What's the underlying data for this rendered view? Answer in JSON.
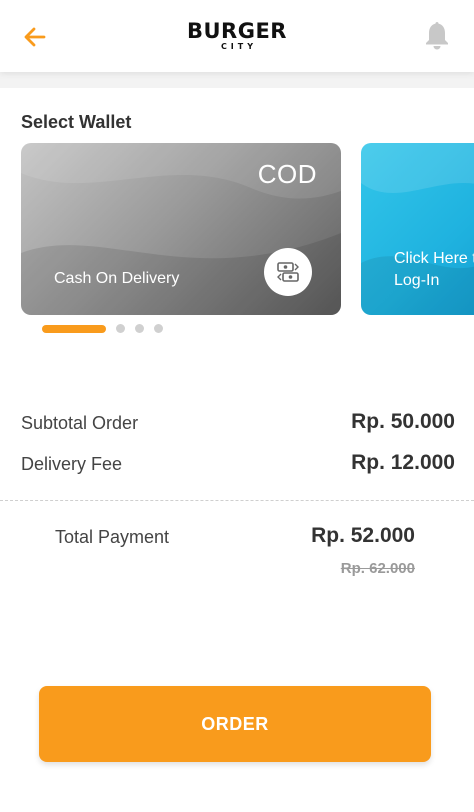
{
  "header": {
    "logo_main": "BURGER",
    "logo_sub": "CITY",
    "back_icon": "arrow-left-icon",
    "bell_icon": "bell-icon",
    "accent_color": "#f99b1c"
  },
  "wallet": {
    "title": "Select Wallet",
    "cards": [
      {
        "badge": "COD",
        "label": "Cash On Delivery",
        "icon": "cash-exchange-icon"
      },
      {
        "label": "Click Here to Log-In"
      }
    ],
    "pagination": {
      "active_index": 0,
      "count": 4
    }
  },
  "summary": {
    "subtotal_label": "Subtotal Order",
    "subtotal_value": "Rp. 50.000",
    "delivery_label": "Delivery Fee",
    "delivery_value": "Rp. 12.000",
    "total_label": "Total Payment",
    "total_value": "Rp. 52.000",
    "original_total": "Rp. 62.000"
  },
  "actions": {
    "order_label": "ORDER"
  }
}
